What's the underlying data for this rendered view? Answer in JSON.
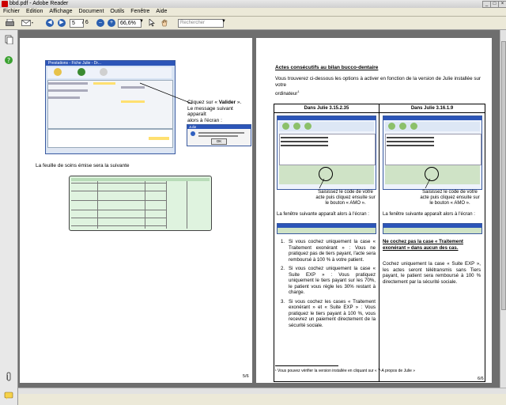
{
  "window": {
    "title": "bbd.pdf - Adobe Reader",
    "min": "_",
    "max": "□",
    "close": "×"
  },
  "menu": [
    "Fichier",
    "Edition",
    "Affichage",
    "Document",
    "Outils",
    "Fenêtre",
    "Aide"
  ],
  "toolbar": {
    "page_current": "5",
    "page_total": "/ 6",
    "zoom": "66,6%",
    "search_placeholder": "Rechercher"
  },
  "left_page": {
    "julie_window_title": "Prestations - Fiche Julie - Dr...",
    "callout_line1": "Cliquez sur « ",
    "callout_bold": "Valider",
    "callout_line1_end": " ».",
    "callout_line2": "Le message suivant apparaît",
    "callout_line3": "alors à l'écran :",
    "msg_title": "Julie",
    "msg_ok": "OK",
    "sheet_caption": "La feuille de soins émise sera la suivante",
    "page_number": "5/6"
  },
  "right_page": {
    "heading": "Actes consécutifs au bilan bucco-dentaire",
    "intro_line1": "Vous trouverez ci-dessous les options à activer en fonction de la version de Julie installée sur votre",
    "intro_line2": "ordinateur",
    "intro_sup": "1",
    "col1_header": "Dans Julie 3.15.2.35",
    "col2_header": "Dans Julie 3.16.1.9",
    "col1_caption": [
      "Saisissez le code de votre",
      "acte puis cliquez ensuite sur",
      "le bouton « AMO »."
    ],
    "col2_caption": [
      "Saisissez le code de votre",
      "acte puis cliquez ensuite sur",
      "le bouton « AMO »."
    ],
    "col1_window_text": "La fenêtre suivante apparaît alors à l'écran :",
    "col2_window_text": "La fenêtre suivante apparaît alors à l'écran :",
    "col1_items": [
      "Si vous cochez uniquement la case « Traitement exonérant » : Vous ne pratiquez pas de tiers payant, l'acte sera remboursé à 100 % à votre patient.",
      "Si vous cochez uniquement la case « Suite EXP » : Vous pratiquez uniquement le tiers payant sur les 70%, le patient vous règle les 30% restant à charge.",
      "Si vous cochez les cases « Traitement exonérant » et « Suite EXP » : Vous pratiquez le tiers payant à 100 %, vous recevrez un paiement directement de la sécurité sociale."
    ],
    "col2_note1": "Ne cochez pas la case « Traitement exonérant » dans aucun des cas.",
    "col2_note2": "Cochez uniquement la case « Suite EXP », les actes seront télétransmis sans Tiers payant, le patient sera remboursé à 100 % directement par la sécurité sociale.",
    "footnote": "¹ Vous pouvez vérifier la version installée en cliquant sur « ?-A propos de Julie »",
    "page_number": "6/6"
  },
  "colors": {
    "accent": "#2c55b8",
    "toolbar": "#ece9d8",
    "background": "#6e6e6e"
  }
}
